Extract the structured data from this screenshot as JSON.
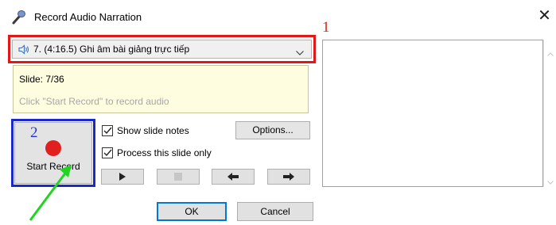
{
  "window": {
    "title": "Record Audio Narration",
    "close_glyph": "✕",
    "title_icon": "microphone-icon"
  },
  "narration": {
    "selected": "7. (4:16.5) Ghi âm bài giảng trực tiếp",
    "speaker_icon": "speaker-icon"
  },
  "annotations": {
    "label_1": "1",
    "label_2": "2",
    "colors": {
      "red": "#e01818",
      "blue": "#1c28c8",
      "green": "#22d422"
    }
  },
  "info": {
    "slide": "Slide: 7/36",
    "hint": "Click \"Start Record\" to record audio"
  },
  "record": {
    "label": "Start Record",
    "dot_color": "#e21f1f"
  },
  "options": {
    "show_slide_notes": {
      "label": "Show slide notes",
      "checked": true
    },
    "process_this_slide_only": {
      "label": "Process this slide only",
      "checked": true
    },
    "options_button": "Options..."
  },
  "transport": {
    "play": "play-icon",
    "stop": "stop-icon",
    "previous": "arrow-left-icon",
    "next": "arrow-right-icon"
  },
  "buttons": {
    "ok": "OK",
    "cancel": "Cancel"
  }
}
